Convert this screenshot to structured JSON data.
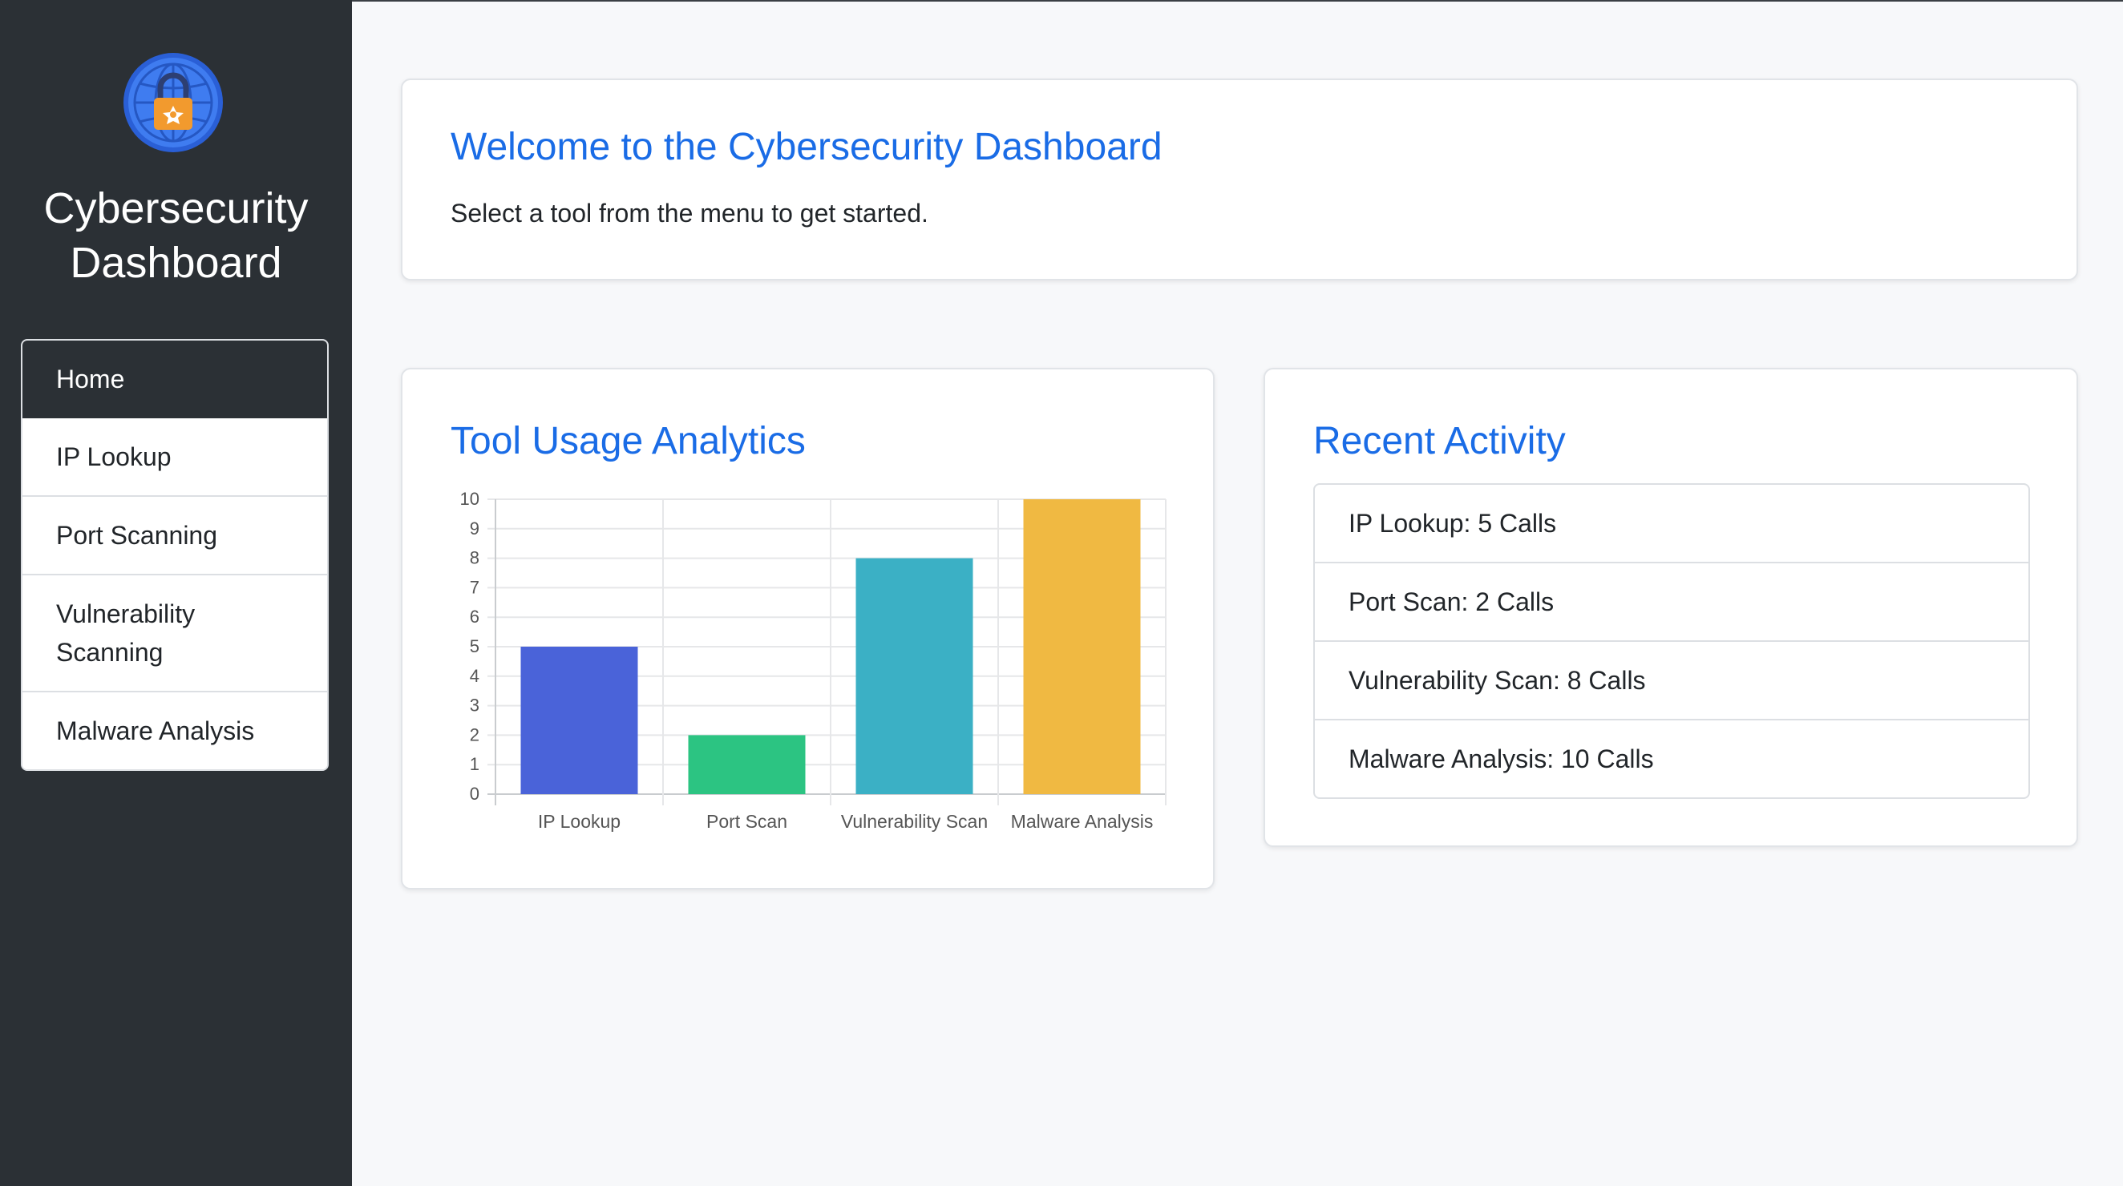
{
  "sidebar": {
    "logo_icon": "globe-lock-icon",
    "brand_line1": "Cybersecurity",
    "brand_line2": "Dashboard",
    "items": [
      {
        "label": "Home",
        "active": true
      },
      {
        "label": "IP Lookup"
      },
      {
        "label": "Port Scanning"
      },
      {
        "label": "Vulnerability",
        "label2": "Scanning"
      },
      {
        "label": "Malware Analysis"
      }
    ]
  },
  "welcome": {
    "title": "Welcome to the Cybersecurity Dashboard",
    "subtitle": "Select a tool from the menu to get started."
  },
  "analytics": {
    "title": "Tool Usage Analytics"
  },
  "chart_data": {
    "type": "bar",
    "categories": [
      "IP Lookup",
      "Port Scan",
      "Vulnerability Scan",
      "Malware Analysis"
    ],
    "values": [
      5,
      2,
      8,
      10
    ],
    "colors": [
      "#4a63d9",
      "#2cc482",
      "#3bb0c5",
      "#f0b942"
    ],
    "ylim": [
      0,
      10
    ],
    "yticks": [
      0,
      1,
      2,
      3,
      4,
      5,
      6,
      7,
      8,
      9,
      10
    ],
    "grid": true
  },
  "activity": {
    "title": "Recent Activity",
    "items": [
      "IP Lookup: 5 Calls",
      "Port Scan: 2 Calls",
      "Vulnerability Scan: 8 Calls",
      "Malware Analysis: 10 Calls"
    ]
  }
}
